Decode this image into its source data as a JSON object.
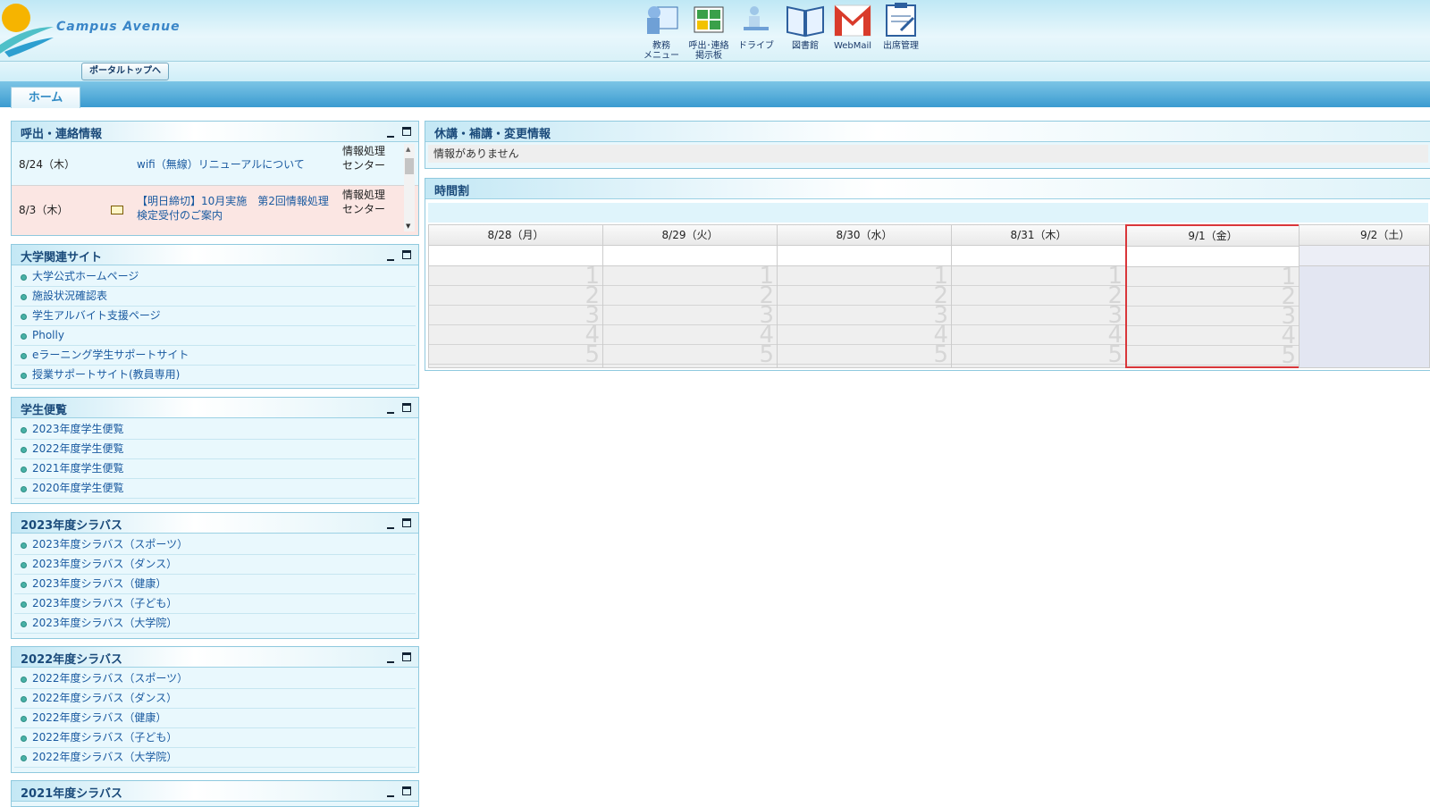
{
  "header": {
    "logo_text": "Campus Avenue",
    "nav": [
      {
        "icon": "academic-menu-icon",
        "label": "教務\nメニュー"
      },
      {
        "icon": "bulletin-board-icon",
        "label": "呼出･連絡\n掲示板"
      },
      {
        "icon": "drive-icon",
        "label": "ドライブ"
      },
      {
        "icon": "library-icon",
        "label": "図書館"
      },
      {
        "icon": "webmail-icon",
        "label": "WebMail"
      },
      {
        "icon": "attendance-icon",
        "label": "出席管理"
      }
    ]
  },
  "subbar": {
    "portal_button": "ポータルトップへ"
  },
  "tabs": {
    "home": "ホーム"
  },
  "panels": {
    "notices": {
      "title": "呼出・連絡情報",
      "rows": [
        {
          "date": "8/24（木）",
          "title": "wifi（無線）リニューアルについて",
          "from": "情報処理センター",
          "mail": false
        },
        {
          "date": "8/3（木）",
          "title": "【明日締切】10月実施　第2回情報処理検定受付のご案内",
          "from": "情報処理センター",
          "mail": true
        }
      ]
    },
    "university_sites": {
      "title": "大学関連サイト",
      "items": [
        "大学公式ホームページ",
        "施設状況確認表",
        "学生アルバイト支援ページ",
        "Pholly",
        "eラーニング学生サポートサイト",
        "授業サポートサイト(教員専用)"
      ]
    },
    "handbook": {
      "title": "学生便覧",
      "items": [
        "2023年度学生便覧",
        "2022年度学生便覧",
        "2021年度学生便覧",
        "2020年度学生便覧"
      ]
    },
    "syllabus_2023": {
      "title": "2023年度シラバス",
      "items": [
        "2023年度シラバス（スポーツ）",
        "2023年度シラバス（ダンス）",
        "2023年度シラバス（健康）",
        "2023年度シラバス（子ども）",
        "2023年度シラバス（大学院）"
      ]
    },
    "syllabus_2022": {
      "title": "2022年度シラバス",
      "items": [
        "2022年度シラバス（スポーツ）",
        "2022年度シラバス（ダンス）",
        "2022年度シラバス（健康）",
        "2022年度シラバス（子ども）",
        "2022年度シラバス（大学院）"
      ]
    },
    "syllabus_2021": {
      "title": "2021年度シラバス"
    }
  },
  "cancellations": {
    "title": "休講・補講・変更情報",
    "message": "情報がありません"
  },
  "timetable": {
    "title": "時間割",
    "days": [
      "8/28（月）",
      "8/29（火）",
      "8/30（水）",
      "8/31（木）",
      "9/1（金）",
      "9/2（土）"
    ],
    "today_index": 4,
    "periods": [
      "1",
      "2",
      "3",
      "4",
      "5"
    ]
  }
}
